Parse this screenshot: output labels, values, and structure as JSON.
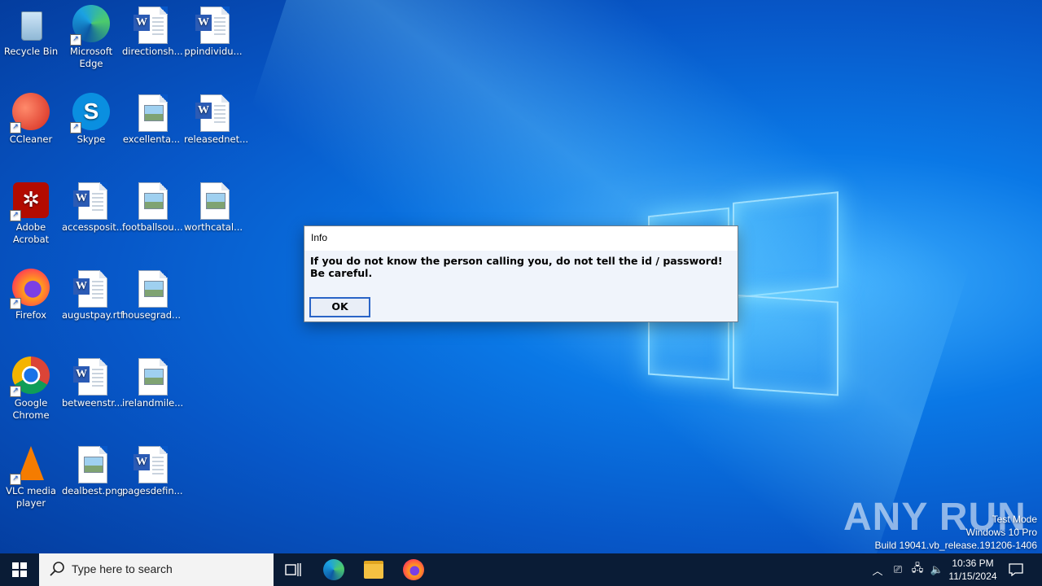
{
  "desktop": {
    "icons": [
      {
        "label": "Recycle Bin"
      },
      {
        "label": "Microsoft Edge"
      },
      {
        "label": "directionsh..."
      },
      {
        "label": "ppindividu..."
      },
      {
        "label": "CCleaner"
      },
      {
        "label": "Skype"
      },
      {
        "label": "excellenta..."
      },
      {
        "label": "releasednet..."
      },
      {
        "label": "Adobe Acrobat"
      },
      {
        "label": "accessposit..."
      },
      {
        "label": "footballsou..."
      },
      {
        "label": "worthcatal..."
      },
      {
        "label": "Firefox"
      },
      {
        "label": "augustpay.rtf"
      },
      {
        "label": "housegrad..."
      },
      {
        "label": "Google Chrome"
      },
      {
        "label": "betweenstr..."
      },
      {
        "label": "irelandmile..."
      },
      {
        "label": "VLC media player"
      },
      {
        "label": "dealbest.png"
      },
      {
        "label": "pagesdefin..."
      }
    ]
  },
  "dialog": {
    "title": "Info",
    "message": "If you do not know the person calling you, do not tell the id / password! Be careful.",
    "ok_label": "OK"
  },
  "watermark": {
    "brand": "ANY RUN",
    "line1": "Test Mode",
    "line2": "Windows 10 Pro",
    "line3": "Build 19041.vb_release.191206-1406"
  },
  "taskbar": {
    "search_placeholder": "Type here to search",
    "time": "10:36 PM",
    "date": "11/15/2024",
    "icons": [
      "windows-start-icon",
      "search-icon",
      "task-view-icon",
      "edge-icon",
      "file-explorer-icon",
      "firefox-icon",
      "chevron-up-icon",
      "meet-now-icon",
      "network-icon",
      "volume-icon",
      "notification-icon"
    ]
  }
}
